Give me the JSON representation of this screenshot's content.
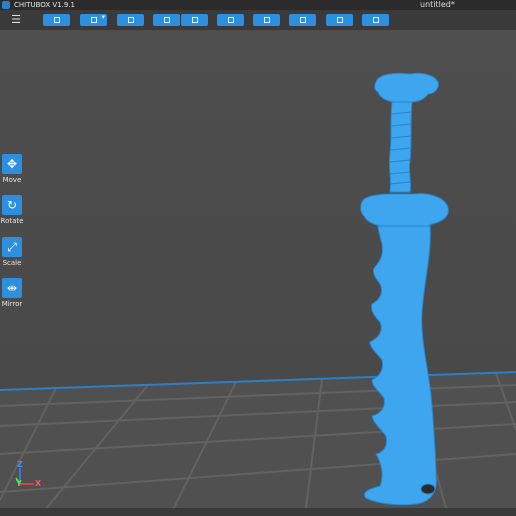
{
  "window": {
    "app_title": "CHITUBOX V1.9.1",
    "document_title": "untitled*"
  },
  "toolbar": {
    "menu_icon": "hamburger-icon",
    "buttons": [
      {
        "icon": "open-file-icon"
      },
      {
        "icon": "save-file-icon"
      },
      {
        "icon": "select-all-icon"
      },
      {
        "icon": "view-front-icon"
      },
      {
        "icon": "view-side-icon"
      },
      {
        "icon": "layers-icon"
      },
      {
        "icon": "support-icon"
      },
      {
        "icon": "hollow-icon"
      },
      {
        "icon": "slice-icon"
      },
      {
        "icon": "print-icon"
      }
    ]
  },
  "left_tools": [
    {
      "label": "Move",
      "icon": "move-icon"
    },
    {
      "label": "Rotate",
      "icon": "rotate-icon"
    },
    {
      "label": "Scale",
      "icon": "scale-icon"
    },
    {
      "label": "Mirror",
      "icon": "mirror-icon"
    }
  ],
  "axes": {
    "z": "Z",
    "y": "Y",
    "x": "X"
  },
  "colors": {
    "model": "#3ea6ee",
    "accent": "#2d8fe0",
    "bed_grid": "#5e5e5e",
    "bed_edge": "#2f7fc0"
  }
}
